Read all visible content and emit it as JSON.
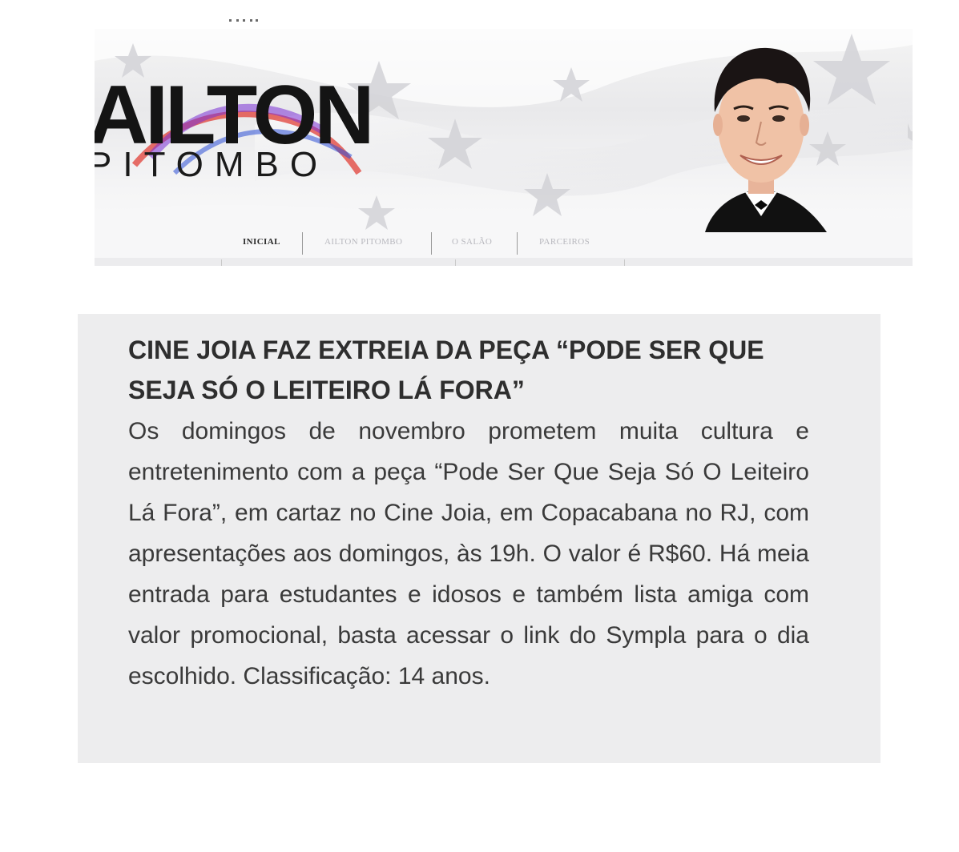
{
  "header": {
    "logo": {
      "line1": "AILTON",
      "line2": "PITOMBO"
    }
  },
  "nav": {
    "items": [
      {
        "label": "INICIAL",
        "active": true
      },
      {
        "label": "AILTON PITOMBO",
        "active": false
      },
      {
        "label": "O SALÃO",
        "active": false
      },
      {
        "label": "PARCEIROS",
        "active": false
      }
    ]
  },
  "article": {
    "title": "CINE JOIA FAZ EXTREIA DA PEÇA “PODE SER QUE SEJA SÓ O LEITEIRO LÁ FORA”",
    "body": "Os domingos de novembro prometem muita cultura e entretenimento com a peça “Pode Ser Que Seja Só O Leiteiro Lá Fora”, em cartaz no Cine Joia, em Copacabana no RJ, com apresentações aos domingos, às 19h. O valor é R$60. Há meia entrada para estudantes e idosos e também lista amiga com valor promocional, basta acessar o link do Sympla para o dia escolhido. Classificação: 14 anos."
  },
  "colors": {
    "article_background": "#ededee",
    "text": "#3a3a3a",
    "nav_active": "#2a2a2a",
    "nav_inactive": "#b8b8be"
  }
}
